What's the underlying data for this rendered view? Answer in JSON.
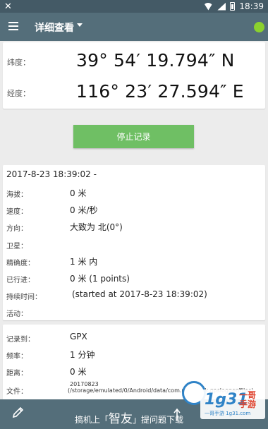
{
  "status_bar": {
    "left_icon": "tool-icon",
    "time": "18:39"
  },
  "app_bar": {
    "title": "详细查看",
    "menu_icon": "hamburger-menu-icon",
    "status_indicator_color": "#8bd12e"
  },
  "coordinates": {
    "latitude_label": "纬度：",
    "latitude_value": "39° 54′ 19.794″ N",
    "longitude_label": "经度：",
    "longitude_value": "116° 23′ 27.594″ E"
  },
  "stop_button": {
    "label": "停止记录",
    "color": "#6fbf64"
  },
  "details": {
    "header": "2017-8-23 18:39:02 -",
    "rows": [
      {
        "label": "海拔：",
        "value": "0 米"
      },
      {
        "label": "速度：",
        "value": "0 米/秒"
      },
      {
        "label": "方向：",
        "value": "大致为 北(0°)"
      },
      {
        "label": "卫星：",
        "value": ""
      },
      {
        "label": "精确度：",
        "value": "1 米 内"
      },
      {
        "label": "已行进：",
        "value": "0 米 (1 points)"
      },
      {
        "label": "持续时间：",
        "value": "(started at 2017-8-23 18:39:02)"
      },
      {
        "label": "活动：",
        "value": ""
      }
    ]
  },
  "logging": {
    "rows": [
      {
        "label": "记录到：",
        "value": "GPX"
      },
      {
        "label": "频率：",
        "value": "1 分钟"
      },
      {
        "label": "距离：",
        "value": "0 米"
      }
    ],
    "file_label": "文件：",
    "file_line1": "20170823",
    "file_line2": "(/storage/emulated/0/Android/data/com.mendhak.gpslogger/files)"
  },
  "bottom_bar": {
    "text_prefix": "搞机上「",
    "text_brand": "智友",
    "text_suffix": "」提问题下载",
    "edit_icon": "pencil-icon",
    "share_icon": "share-icon"
  },
  "watermark": {
    "logo_text": "1g31",
    "brand": "一哥",
    "brand2": "手游",
    "url": "一哥手游 1g31.com"
  }
}
